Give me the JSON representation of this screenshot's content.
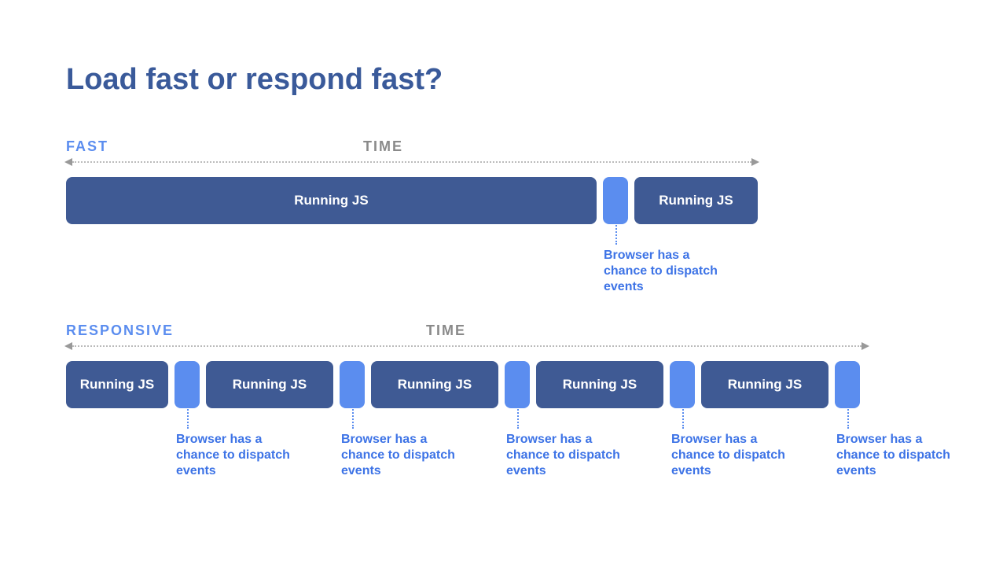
{
  "title": "Load fast or respond fast?",
  "labels": {
    "time": "TIME",
    "running_js": "Running JS",
    "dispatch": "Browser has a chance to dispatch events"
  },
  "sections": {
    "fast": {
      "label": "FAST"
    },
    "responsive": {
      "label": "RESPONSIVE"
    }
  },
  "colors": {
    "dark_block": "#3f5a94",
    "light_block": "#5b8def",
    "title": "#3a5a9a",
    "axis_gray": "#8a8a8a"
  }
}
